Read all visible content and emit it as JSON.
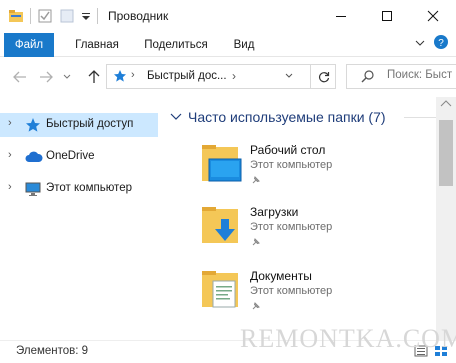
{
  "window": {
    "title": "Проводник"
  },
  "ribbon": {
    "tabs": [
      {
        "label": "Файл"
      },
      {
        "label": "Главная"
      },
      {
        "label": "Поделиться"
      },
      {
        "label": "Вид"
      }
    ]
  },
  "address": {
    "path": "Быстрый дос..."
  },
  "search": {
    "placeholder": "Поиск: Быст"
  },
  "nav": {
    "items": [
      {
        "label": "Быстрый доступ",
        "icon": "star-icon",
        "selected": true
      },
      {
        "label": "OneDrive",
        "icon": "cloud-icon",
        "selected": false
      },
      {
        "label": "Этот компьютер",
        "icon": "computer-icon",
        "selected": false
      }
    ]
  },
  "content": {
    "group_title": "Часто используемые папки (7)",
    "folders": [
      {
        "name": "Рабочий стол",
        "location": "Этот компьютер",
        "icon": "desktop-folder-icon"
      },
      {
        "name": "Загрузки",
        "location": "Этот компьютер",
        "icon": "downloads-folder-icon"
      },
      {
        "name": "Документы",
        "location": "Этот компьютер",
        "icon": "documents-folder-icon"
      }
    ]
  },
  "status": {
    "items_count": "Элементов: 9"
  },
  "watermark": "REMONTKA.COM",
  "colors": {
    "accent": "#1979ca",
    "selection": "#cce8ff",
    "group_title": "#1f3d7a",
    "folder": "#f4c757"
  }
}
